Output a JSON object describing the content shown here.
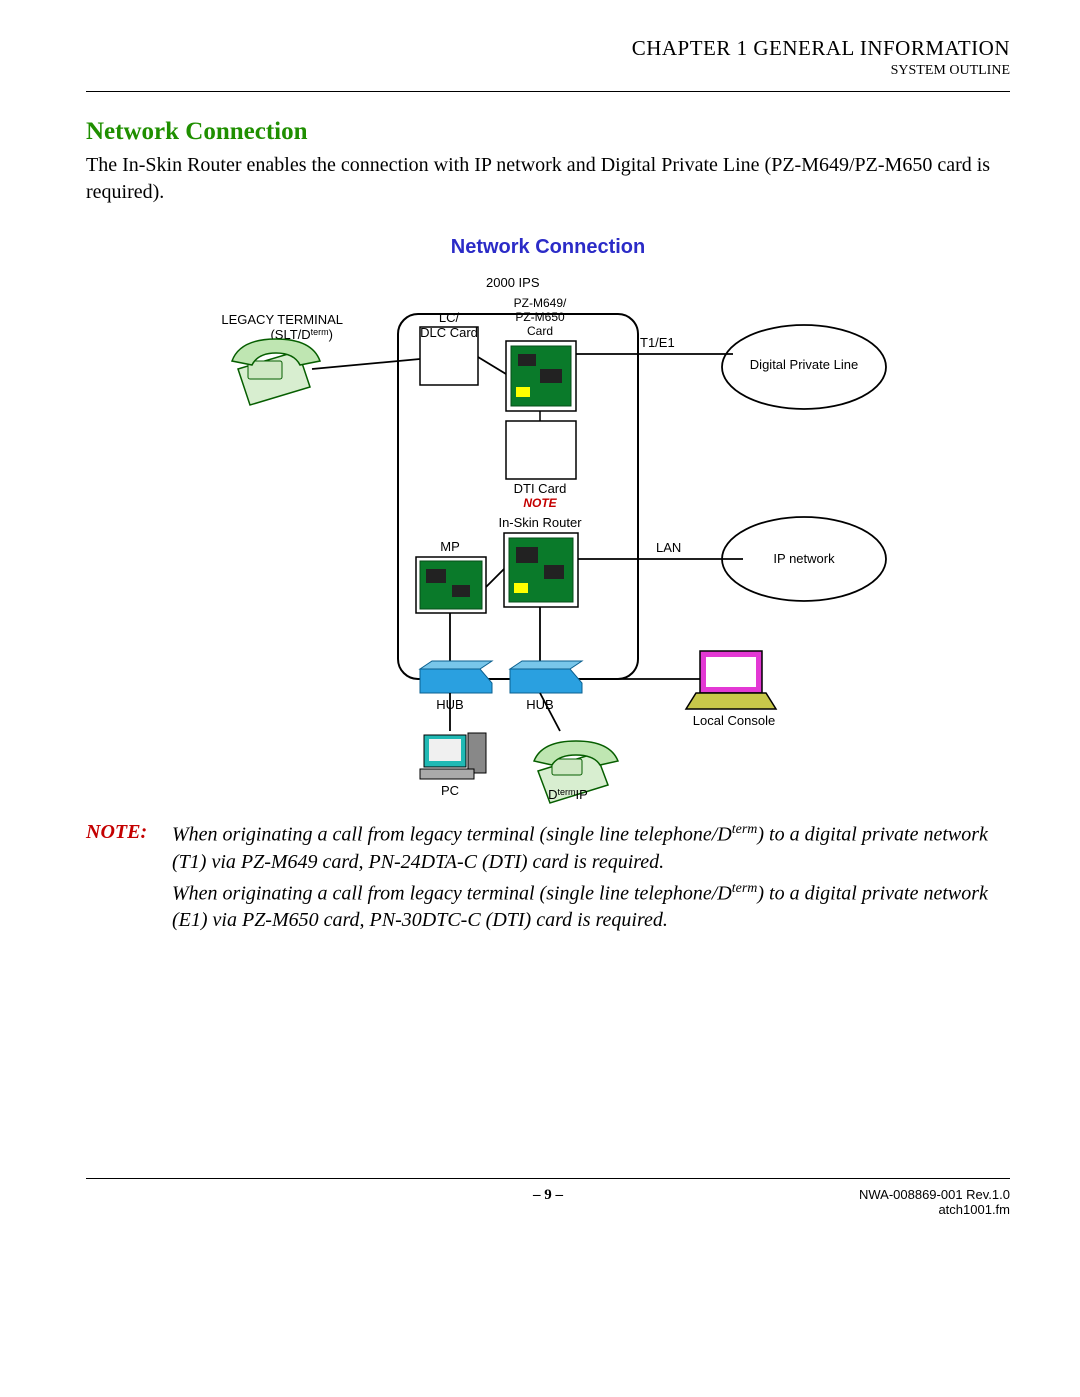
{
  "header": {
    "chapter": "CHAPTER 1  GENERAL INFORMATION",
    "outline": "SYSTEM OUTLINE"
  },
  "section": {
    "heading": "Network Connection",
    "paragraph": "The In-Skin Router enables the connection with IP network and Digital Private Line (PZ-M649/PZ-M650 card is required)."
  },
  "figure": {
    "title": "Network Connection",
    "labels": {
      "ips": "2000 IPS",
      "legacy1": "LEGACY TERMINAL",
      "legacy2_a": "(SLT/D",
      "legacy2_b": "term",
      "legacy2_c": ")",
      "lc1": "LC/",
      "lc2": "DLC Card",
      "pzm1": "PZ-M649/",
      "pzm2": "PZ-M650",
      "pzm3": "Card",
      "t1e1": "T1/E1",
      "dpl": "Digital Private Line",
      "dti": "DTI Card",
      "note": "NOTE",
      "inskin": "In-Skin Router",
      "mp": "MP",
      "lan": "LAN",
      "ipnet": "IP network",
      "hub1": "HUB",
      "hub2": "HUB",
      "local": "Local Console",
      "pc": "PC",
      "dtermip_a": "D",
      "dtermip_b": "term",
      "dtermip_c": "IP"
    }
  },
  "note": {
    "key": "NOTE:",
    "p1_a": "When originating a call from legacy terminal (single line telephone/D",
    "p1_b": "term",
    "p1_c": ") to a digital private network (T1) via PZ-M649 card, PN-24DTA-C (DTI) card is required.",
    "p2_a": "When originating a call from legacy terminal (single line telephone/D",
    "p2_b": "term",
    "p2_c": ") to a digital private network (E1) via PZ-M650 card, PN-30DTC-C (DTI) card is required."
  },
  "footer": {
    "page": "– 9 –",
    "doc": "NWA-008869-001 Rev.1.0",
    "file": "atch1001.fm"
  }
}
